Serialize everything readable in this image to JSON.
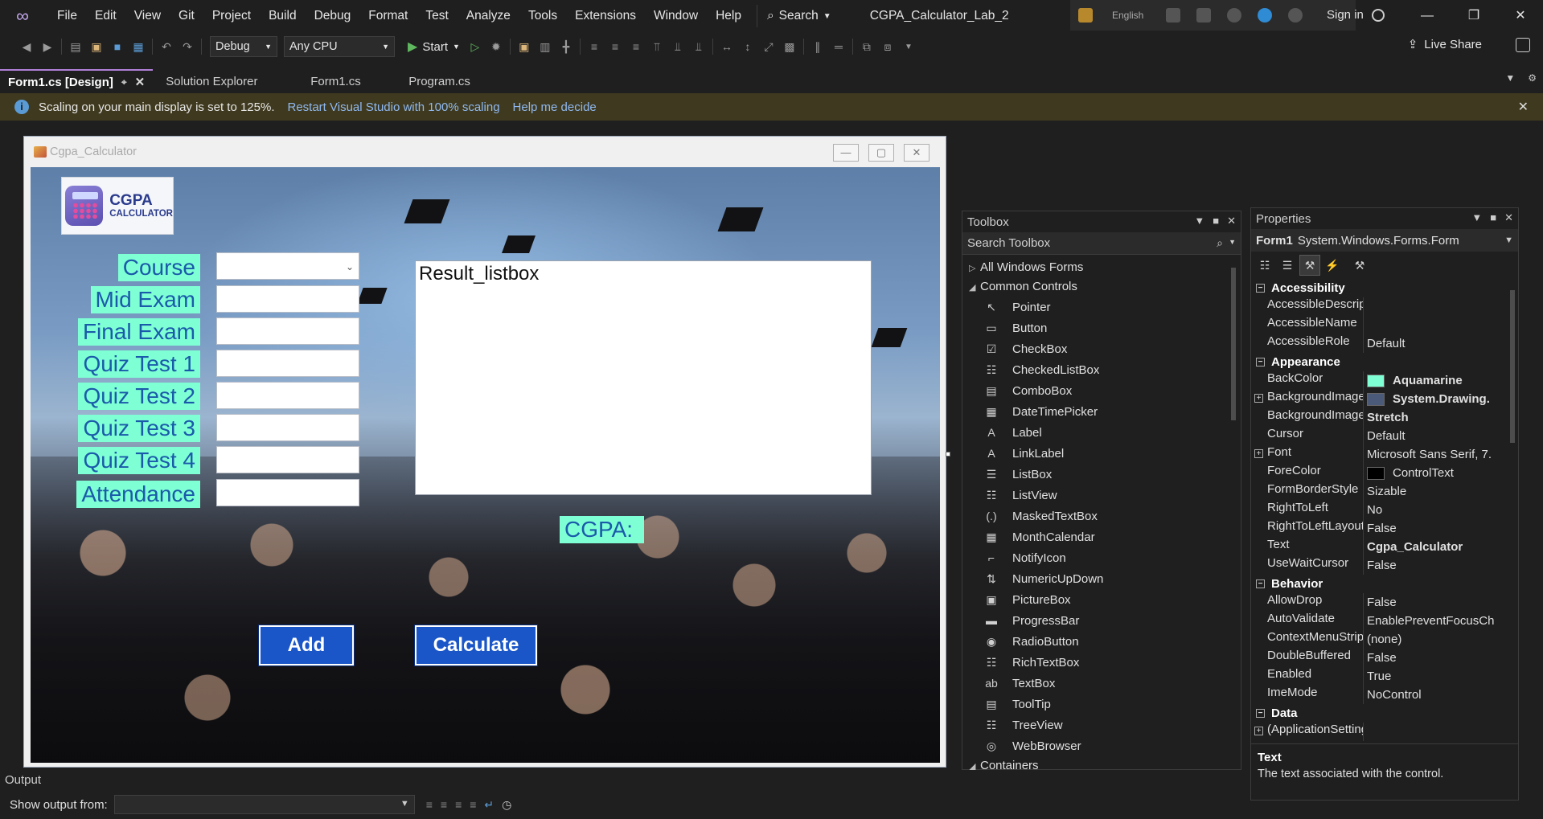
{
  "titlebar": {
    "menu": [
      "File",
      "Edit",
      "View",
      "Git",
      "Project",
      "Build",
      "Debug",
      "Format",
      "Test",
      "Analyze",
      "Tools",
      "Extensions",
      "Window",
      "Help"
    ],
    "search_label": "Search",
    "solution_title": "CGPA_Calculator_Lab_2",
    "language": "English",
    "sign_in": "Sign in"
  },
  "toolbar": {
    "configuration": "Debug",
    "platform": "Any CPU",
    "start_label": "Start",
    "live_share": "Live Share"
  },
  "tabs": [
    {
      "label": "Form1.cs [Design]",
      "active": true
    },
    {
      "label": "Solution Explorer",
      "active": false
    },
    {
      "label": "Form1.cs",
      "active": false
    },
    {
      "label": "Program.cs",
      "active": false
    }
  ],
  "infobar": {
    "message": "Scaling on your main display is set to 125%.",
    "link_restart": "Restart Visual Studio with 100% scaling",
    "link_help": "Help me decide"
  },
  "form": {
    "title": "Cgpa_Calculator",
    "logo_line1": "CGPA",
    "logo_line2": "CALCULATOR",
    "labels": [
      "Course",
      "Mid Exam",
      "Final Exam",
      "Quiz Test 1",
      "Quiz Test 2",
      "Quiz Test 3",
      "Quiz Test 4",
      "Attendance"
    ],
    "listbox_label": "Result_listbox",
    "cgpa_label": "CGPA:",
    "add_button": "Add",
    "calculate_button": "Calculate"
  },
  "toolbox": {
    "title": "Toolbox",
    "search_placeholder": "Search Toolbox",
    "group_all": "All Windows Forms",
    "group_common": "Common Controls",
    "items": [
      {
        "label": "Pointer",
        "icon": "pointer-icon"
      },
      {
        "label": "Button",
        "icon": "button-icon"
      },
      {
        "label": "CheckBox",
        "icon": "checkbox-icon"
      },
      {
        "label": "CheckedListBox",
        "icon": "checkedlistbox-icon"
      },
      {
        "label": "ComboBox",
        "icon": "combobox-icon"
      },
      {
        "label": "DateTimePicker",
        "icon": "datetimepicker-icon"
      },
      {
        "label": "Label",
        "icon": "label-icon"
      },
      {
        "label": "LinkLabel",
        "icon": "linklabel-icon"
      },
      {
        "label": "ListBox",
        "icon": "listbox-icon"
      },
      {
        "label": "ListView",
        "icon": "listview-icon"
      },
      {
        "label": "MaskedTextBox",
        "icon": "maskedtextbox-icon"
      },
      {
        "label": "MonthCalendar",
        "icon": "monthcalendar-icon"
      },
      {
        "label": "NotifyIcon",
        "icon": "notifyicon-icon"
      },
      {
        "label": "NumericUpDown",
        "icon": "numericupdown-icon"
      },
      {
        "label": "PictureBox",
        "icon": "picturebox-icon"
      },
      {
        "label": "ProgressBar",
        "icon": "progressbar-icon"
      },
      {
        "label": "RadioButton",
        "icon": "radiobutton-icon"
      },
      {
        "label": "RichTextBox",
        "icon": "richtextbox-icon"
      },
      {
        "label": "TextBox",
        "icon": "textbox-icon"
      },
      {
        "label": "ToolTip",
        "icon": "tooltip-icon"
      },
      {
        "label": "TreeView",
        "icon": "treeview-icon"
      },
      {
        "label": "WebBrowser",
        "icon": "webbrowser-icon"
      }
    ],
    "group_containers": "Containers"
  },
  "properties": {
    "title": "Properties",
    "object_name": "Form1",
    "object_type": "System.Windows.Forms.Form",
    "categories": [
      {
        "name": "Accessibility",
        "rows": [
          {
            "name": "AccessibleDescriptio",
            "value": ""
          },
          {
            "name": "AccessibleName",
            "value": ""
          },
          {
            "name": "AccessibleRole",
            "value": "Default"
          }
        ]
      },
      {
        "name": "Appearance",
        "rows": [
          {
            "name": "BackColor",
            "value": "Aquamarine",
            "swatch": "#7fffd4",
            "bold": true
          },
          {
            "name": "BackgroundImage",
            "value": "System.Drawing.",
            "swatch": "#4a5a78",
            "bold": true,
            "expand": true
          },
          {
            "name": "BackgroundImageLa",
            "value": "Stretch",
            "bold": true
          },
          {
            "name": "Cursor",
            "value": "Default"
          },
          {
            "name": "Font",
            "value": "Microsoft Sans Serif, 7.",
            "expand": true
          },
          {
            "name": "ForeColor",
            "value": "ControlText",
            "swatch": "#000000"
          },
          {
            "name": "FormBorderStyle",
            "value": "Sizable"
          },
          {
            "name": "RightToLeft",
            "value": "No"
          },
          {
            "name": "RightToLeftLayout",
            "value": "False"
          },
          {
            "name": "Text",
            "value": "Cgpa_Calculator",
            "bold": true
          },
          {
            "name": "UseWaitCursor",
            "value": "False"
          }
        ]
      },
      {
        "name": "Behavior",
        "rows": [
          {
            "name": "AllowDrop",
            "value": "False"
          },
          {
            "name": "AutoValidate",
            "value": "EnablePreventFocusCh"
          },
          {
            "name": "ContextMenuStrip",
            "value": "(none)"
          },
          {
            "name": "DoubleBuffered",
            "value": "False"
          },
          {
            "name": "Enabled",
            "value": "True"
          },
          {
            "name": "ImeMode",
            "value": "NoControl"
          }
        ]
      },
      {
        "name": "Data",
        "rows": [
          {
            "name": "(ApplicationSettings)",
            "value": "",
            "expand": true
          }
        ]
      }
    ],
    "desc_title": "Text",
    "desc_text": "The text associated with the control."
  },
  "output": {
    "title": "Output",
    "show_from": "Show output from:"
  },
  "colors": {
    "accent": "#b180d7",
    "form_label_bg": "#7fffd4",
    "form_label_fg": "#1a5aaa",
    "button_bg": "#1a56c8"
  }
}
